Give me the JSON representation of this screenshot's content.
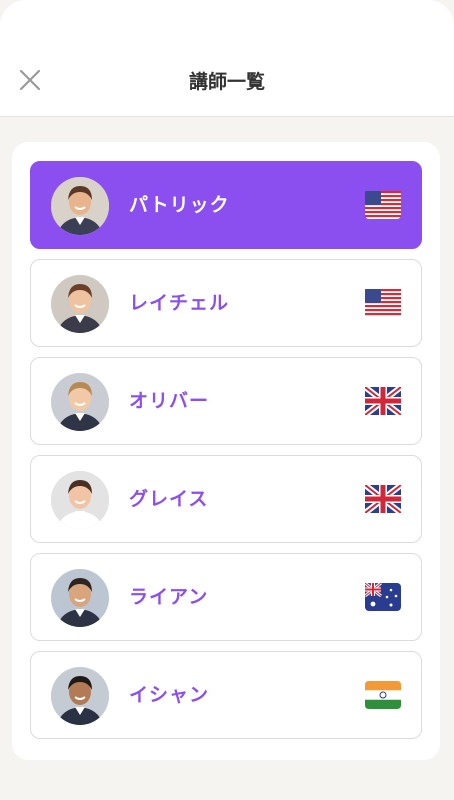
{
  "header": {
    "title": "講師一覧",
    "close_icon": "close-icon"
  },
  "colors": {
    "accent": "#8b4ff0",
    "background": "#f5f4f1",
    "card_border": "#dcdcdc"
  },
  "tutors": [
    {
      "name": "パトリック",
      "flag": "us-flag-icon",
      "selected": true
    },
    {
      "name": "レイチェル",
      "flag": "us-flag-icon",
      "selected": false
    },
    {
      "name": "オリバー",
      "flag": "uk-flag-icon",
      "selected": false
    },
    {
      "name": "グレイス",
      "flag": "uk-flag-icon",
      "selected": false
    },
    {
      "name": "ライアン",
      "flag": "australia-flag-icon",
      "selected": false
    },
    {
      "name": "イシャン",
      "flag": "india-flag-icon",
      "selected": false
    }
  ]
}
